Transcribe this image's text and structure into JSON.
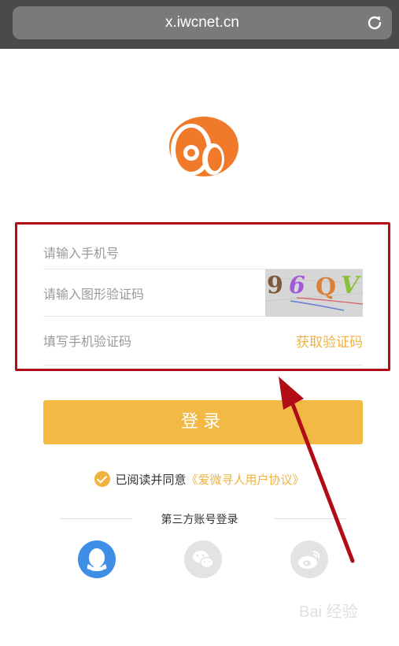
{
  "browser": {
    "url": "x.iwcnet.cn"
  },
  "form": {
    "phone_placeholder": "请输入手机号",
    "captcha_placeholder": "请输入图形验证码",
    "captcha_text": "96QV",
    "sms_placeholder": "填写手机验证码",
    "get_code_label": "获取验证码"
  },
  "login_label": "登录",
  "agreement": {
    "prefix": "已阅读并同意",
    "link": "《爱微寻人用户协议》"
  },
  "third_party": {
    "title": "第三方账号登录",
    "providers": [
      "qq-icon",
      "wechat-icon",
      "weibo-icon"
    ]
  },
  "watermark": "Bai 经验",
  "colors": {
    "accent": "#f2b945",
    "logo": "#f07a2a",
    "qq": "#3f8ee6",
    "annotation": "#b00d17"
  }
}
